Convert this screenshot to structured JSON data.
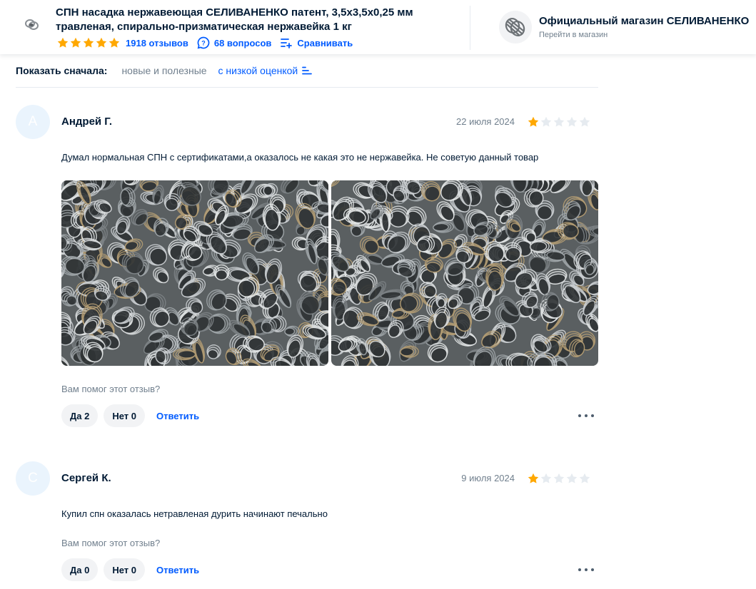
{
  "product": {
    "title": "СПН насадка нержавеющая СЕЛИВАНЕНКО патент, 3,5х3,5х0,25 мм травленая, спирально-призматическая нержавейка 1 кг",
    "reviews_link": "1918 отзывов",
    "questions_link": "68 вопросов",
    "compare_link": "Сравнивать",
    "rating": 5
  },
  "shop": {
    "name": "Официальный магазин СЕЛИВАНЕНКО",
    "subtitle": "Перейти в магазин"
  },
  "sort": {
    "label": "Показать сначала:",
    "options": [
      "новые и полезные",
      "с низкой оценкой"
    ],
    "active": "с низкой оценкой"
  },
  "reviews": [
    {
      "avatar_letter": "А",
      "author": "Андрей Г.",
      "date": "22 июля 2024",
      "rating": 1,
      "text": "Думал нормальная СПН с сертификатами,а оказалось не какая это не нержавейка. Не советую данный товар",
      "photos": 2,
      "helpful_question": "Вам помог этот отзыв?",
      "yes_label": "Да 2",
      "no_label": "Нет 0",
      "reply_label": "Ответить"
    },
    {
      "avatar_letter": "С",
      "author": "Сергей К.",
      "date": "9 июля 2024",
      "rating": 1,
      "text": "Купил спн оказалась нетравленая дурить начинают печально",
      "photos": 0,
      "helpful_question": "Вам помог этот отзыв?",
      "yes_label": "Да 0",
      "no_label": "Нет 0",
      "reply_label": "Ответить"
    }
  ],
  "colors": {
    "accent": "#005bff",
    "star_filled": "#ffa800",
    "star_empty": "#e6ebf0",
    "text_primary": "#001a34",
    "text_secondary": "#707f8d"
  }
}
